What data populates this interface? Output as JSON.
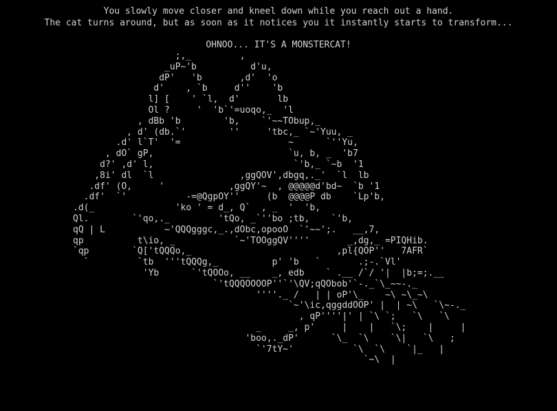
{
  "story": {
    "line1": "You slowly move closer and kneel down while you reach out a hand.",
    "line2": "The cat turns around, but as soon as it notices you it instantly starts to transform...",
    "exclamation": "OHNOO... IT'S A MONSTERCAT!"
  },
  "art_lines": [
    "                   ;,_         ,",
    "                 _uP~'b          d'u,",
    "                dP'   'b       ,d'  'o",
    "               d'    , `b     d''    'b",
    "              l] [    ' `l,  d'       lb",
    "              Ol ?     '  'b`'=uoqo,_  'l",
    "            , dBb 'b        'b,    `'~~TObup,_",
    "          , d' (db.`'        ''     'tbc,_ `~'Yuu, _",
    "        .d' l`T'  '=                    ~      `''Yu,",
    "      , dO` gP,                         `u, b, _  'b7",
    "     d?' ,d' l,                          `'b,_ `~b  '1",
    "    ,8i' dl  `l                ,ggQOV',dbgq,._'  `l  lb",
    "   .df' (O,     '            ,ggQY'~  , @@@@@d'bd~  `b '1",
    "  .df'  `'           -=@QgpOY''     (b  @@@@P db    `Lp'b,",
    ".d(_               'ko ' = d_, Q`  , _  '  'b,",
    "Ql.        `'qo,._         'tQo, _`''bo ;tb,    `'b,",
    "qQ | L           ~'QQQgggc,_.,dObc,opooO  `'~~';.   __,7,",
    "qp          t\\io, _           `~'TOOggQV''''       _,dg,_ =PIQHib.",
    "`qp        `Q['tQQQo,_                           ,pl{QOP''   7AFR`",
    "  `         `tb  '''tQQQg,_          p' 'b   `       .;-.`Vl'",
    "             'Yb      `'tQOOo, __    _, edb    ` .__ /`/ '|  |b;=;.__",
    "                          `'tQQQOOOOP''`'\\QV;qQObob'`-._`\\_~~-._",
    "                                  ''''._ /   | | oP'\\_    ~\\ ~\\_~\\",
    "                                        `~'\\ic,qggddOOP' |  | ~\\   `\\~-._",
    "                                          , qP''''|' | `\\ `;   `\\   `\\",
    "                                  _     _, p'     |    |   `\\;    |     |",
    "                                'boo,._dP'      `\\_  `\\    `\\|   `\\   ;",
    "                                  `'7tY~'           `\\  `\\    `|_   |",
    "                                                      `~\\  |"
  ]
}
